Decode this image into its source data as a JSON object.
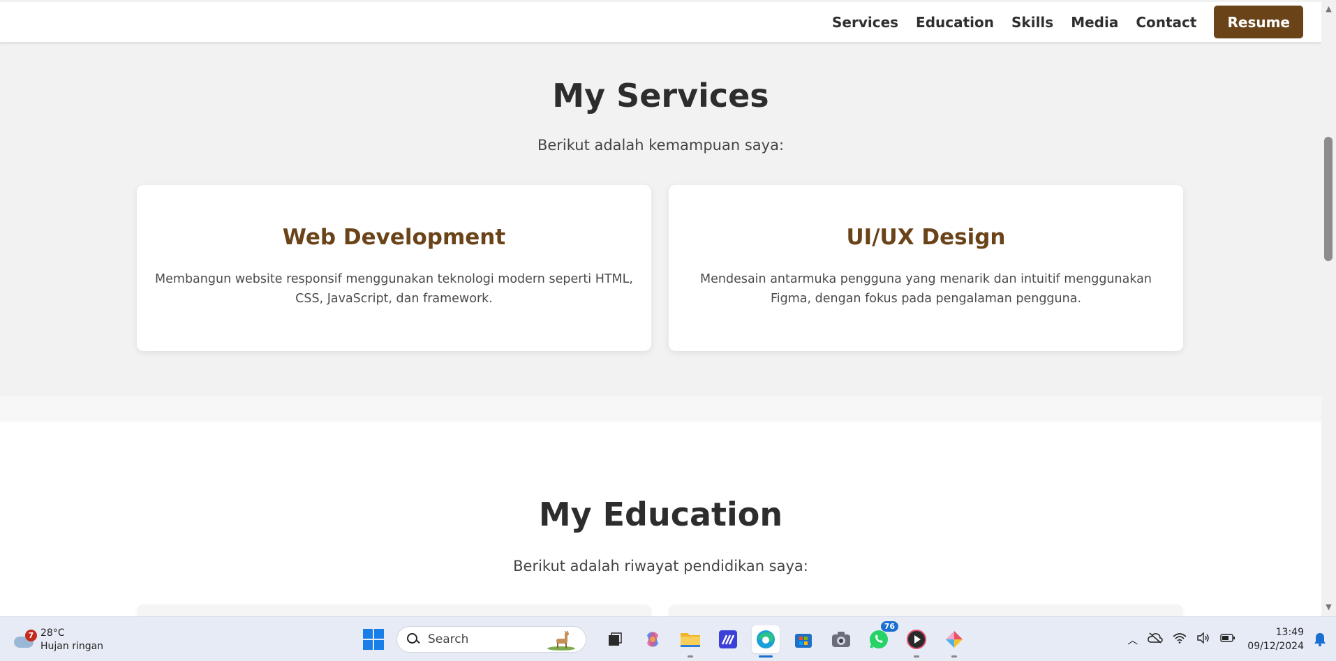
{
  "nav": {
    "links": [
      "Services",
      "Education",
      "Skills",
      "Media",
      "Contact"
    ],
    "resume_label": "Resume"
  },
  "services": {
    "title": "My Services",
    "subtitle": "Berikut adalah kemampuan saya:",
    "cards": [
      {
        "title": "Web Development",
        "description": "Membangun website responsif menggunakan teknologi modern seperti HTML, CSS, JavaScript, dan framework."
      },
      {
        "title": "UI/UX Design",
        "description": "Mendesain antarmuka pengguna yang menarik dan intuitif menggunakan Figma, dengan fokus pada pengalaman pengguna."
      }
    ]
  },
  "education": {
    "title": "My Education",
    "subtitle": "Berikut adalah riwayat pendidikan saya:"
  },
  "taskbar": {
    "weather_temp": "28°C",
    "weather_desc": "Hujan ringan",
    "weather_badge": "7",
    "search_placeholder": "Search",
    "whatsapp_badge": "76",
    "time": "13:49",
    "date": "09/12/2024"
  },
  "colors": {
    "accent": "#6a4319",
    "page_bg": "#f2f2f2",
    "card_bg": "#ffffff",
    "heading": "#2d2d2d"
  }
}
